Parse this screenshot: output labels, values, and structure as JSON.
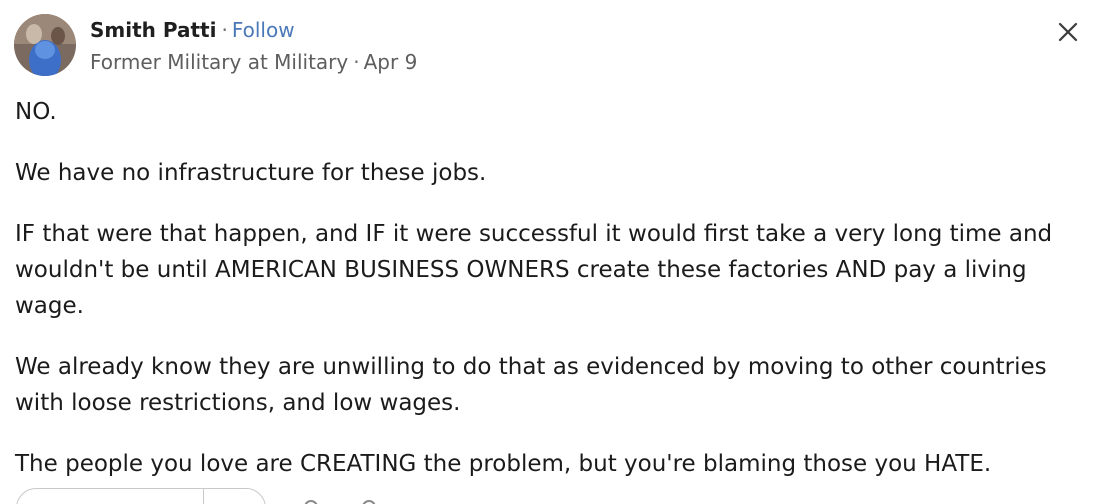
{
  "author": {
    "name": "Smith Patti",
    "separator": "·",
    "follow_label": "Follow",
    "headline": "Former Military at Military",
    "date": "Apr 9"
  },
  "icons": {
    "close": "close-icon",
    "avatar": "avatar"
  },
  "post": {
    "paragraphs": [
      "NO.",
      "We have no infrastructure for these jobs.",
      "IF that were that happen, and IF it were successful it would first take a very long time and wouldn't be until AMERICAN BUSINESS OWNERS create these factories AND pay a living wage.",
      "We already know they are unwilling to do that as evidenced by moving to other countries with loose restrictions, and low wages.",
      "The people you love are CREATING the problem, but you're blaming those you HATE."
    ]
  },
  "colors": {
    "follow": "#4a78b8",
    "secondary_text": "#5e5e5e",
    "body_text": "#1b1b1b"
  }
}
